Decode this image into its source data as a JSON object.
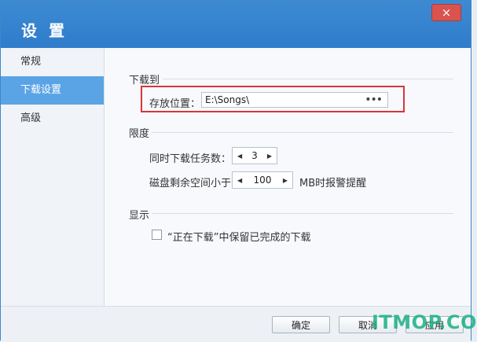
{
  "window": {
    "title": "设 置",
    "close_glyph": "×"
  },
  "sidebar": {
    "items": [
      {
        "label": "常规"
      },
      {
        "label": "下载设置"
      },
      {
        "label": "高级"
      }
    ]
  },
  "download_to": {
    "section_title": "下载到",
    "save_location_label": "存放位置：",
    "path_value": "E:\\Songs\\",
    "browse_glyph": "•••"
  },
  "limits": {
    "section_title": "限度",
    "concurrent_label": "同时下载任务数：",
    "concurrent_value": "3",
    "disk_label": "磁盘剩余空间小于",
    "disk_value": "100",
    "disk_suffix": "MB时报警提醒"
  },
  "display": {
    "section_title": "显示",
    "keep_completed_label": "“正在下载”中保留已完成的下载"
  },
  "footer": {
    "ok_label": "确定",
    "cancel_label": "取消",
    "apply_label": "应用"
  },
  "watermark": {
    "text": "ITMOP.COM"
  },
  "colors": {
    "title_bar": "#2f7ccb",
    "sidebar_active": "#5aa4e5",
    "highlight_box": "#d7353b"
  }
}
